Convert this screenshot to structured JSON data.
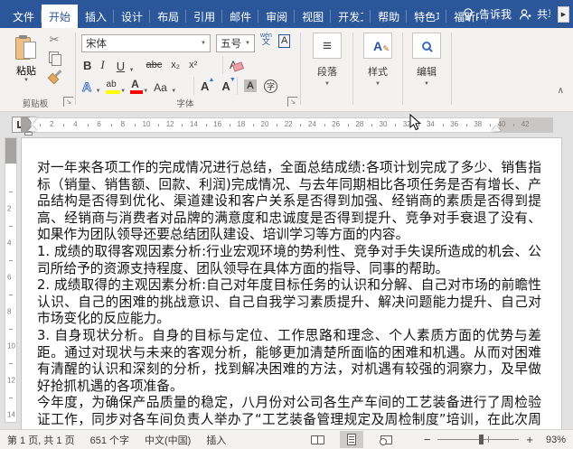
{
  "titlebar": {
    "tabs": [
      {
        "id": "file",
        "label": "文件",
        "active": false,
        "clipped": false
      },
      {
        "id": "home",
        "label": "开始",
        "active": true,
        "clipped": false
      },
      {
        "id": "insert",
        "label": "插入",
        "active": false,
        "clipped": false
      },
      {
        "id": "design",
        "label": "设计",
        "active": false,
        "clipped": false
      },
      {
        "id": "layout",
        "label": "布局",
        "active": false,
        "clipped": false
      },
      {
        "id": "references",
        "label": "引用",
        "active": false,
        "clipped": false
      },
      {
        "id": "mailings",
        "label": "邮件",
        "active": false,
        "clipped": false
      },
      {
        "id": "review",
        "label": "审阅",
        "active": false,
        "clipped": false
      },
      {
        "id": "view",
        "label": "视图",
        "active": false,
        "clipped": false
      },
      {
        "id": "developer",
        "label": "开发工具",
        "active": false,
        "clipped": true
      },
      {
        "id": "help",
        "label": "帮助",
        "active": false,
        "clipped": false
      },
      {
        "id": "features",
        "label": "特色功能",
        "active": false,
        "clipped": true
      },
      {
        "id": "foxit",
        "label": "福昕PDF",
        "active": false,
        "clipped": true
      }
    ],
    "tell_me_label": "告诉我",
    "share_label": "共享",
    "expand_arrow": "▶"
  },
  "ribbon": {
    "paste_label": "粘贴",
    "groups": {
      "clipboard": "剪贴板",
      "font": "字体"
    },
    "font_name": "宋体",
    "font_size": "五号",
    "glyphs": {
      "bold": "B",
      "italic": "I",
      "underline": "U",
      "strikethrough": "abc",
      "subscript": "x₂",
      "superscript": "x²",
      "clear_format": "A",
      "text_effects": "A",
      "highlight": "ab",
      "font_color": "A",
      "change_case": "Aa",
      "grow_font": "A",
      "shrink_font": "A",
      "grow_caret": "▲",
      "shrink_caret": "▼",
      "shading": "A",
      "enclose": "字",
      "phonetic_top": "wén",
      "phonetic_bottom": "文",
      "char_border": "A",
      "paragraph_icon": "≡",
      "styles_icon": "A",
      "dropdown": "▼",
      "launcher_arrow": "↘",
      "collapse_chevron": "∧"
    },
    "collapsed": [
      {
        "id": "paragraph",
        "label": "段落"
      },
      {
        "id": "styles",
        "label": "样式"
      },
      {
        "id": "editing",
        "label": "编辑"
      }
    ]
  },
  "ruler": {
    "horizontal_numbers": [
      2,
      4,
      6,
      8,
      10,
      12,
      14,
      16,
      18,
      20,
      22,
      24,
      26,
      28,
      30,
      32,
      34,
      36,
      38,
      40,
      42
    ],
    "vertical_numbers": [
      2,
      4,
      6,
      8,
      10,
      12,
      14
    ]
  },
  "document": {
    "paragraphs": [
      "对一年来各项工作的完成情况进行总结，全面总结成绩:各项计划完成了多少、销售指标（销量、销售额、回款、利润)完成情况、与去年同期相比各项任务是否有增长、产品结构是否得到优化、渠道建设和客户关系是否得到加强、经销商的素质是否得到提高、经销商与消费者对品牌的满意度和忠诚度是否得到提升、竞争对手衰退了没有、如果作为团队领导还要总结团队建设、培训学习等方面的内容。",
      "1. 成绩的取得客观因素分析:行业宏观环境的势利性、竞争对手失误所造成的机会、公司所给予的资源支持程度、团队领导在具体方面的指导、同事的帮助。",
      "2. 成绩取得的主观因素分析:自己对年度目标任务的认识和分解、自己对市场的前瞻性认识、自己的困难的挑战意识、自己自我学习素质提升、解决问题能力提升、自己对市场变化的反应能力。",
      "3. 自身现状分析。自身的目标与定位、工作思路和理念、个人素质方面的优势与差距。通过对现状与未来的客观分析，能够更加清楚所面临的困难和机遇。从而对困难有清醒的认识和深刻的分析，找到解决困难的方法，对机遇有较强的洞察力，及早做好抢抓机遇的各项准备。",
      "今年度，为确保产品质量的稳定，八月份对公司各生产车间的工艺装备进行了周检验证工作，同步对各车间负责人举办了“工艺装备管理规定及周检制度”培训，在此次周检验证"
    ]
  },
  "statusbar": {
    "page_info": "第 1 页, 共 1 页",
    "word_count": "651 个字",
    "language": "中文(中国)",
    "insert_mode": "插入",
    "zoom_minus": "−",
    "zoom_plus": "+",
    "zoom_level": "93%"
  },
  "colors": {
    "titlebar_blue": "#2b579a",
    "highlight_yellow": "#ffff00",
    "font_color_red": "#ff0000",
    "clipboard_tan": "#edc08a"
  }
}
